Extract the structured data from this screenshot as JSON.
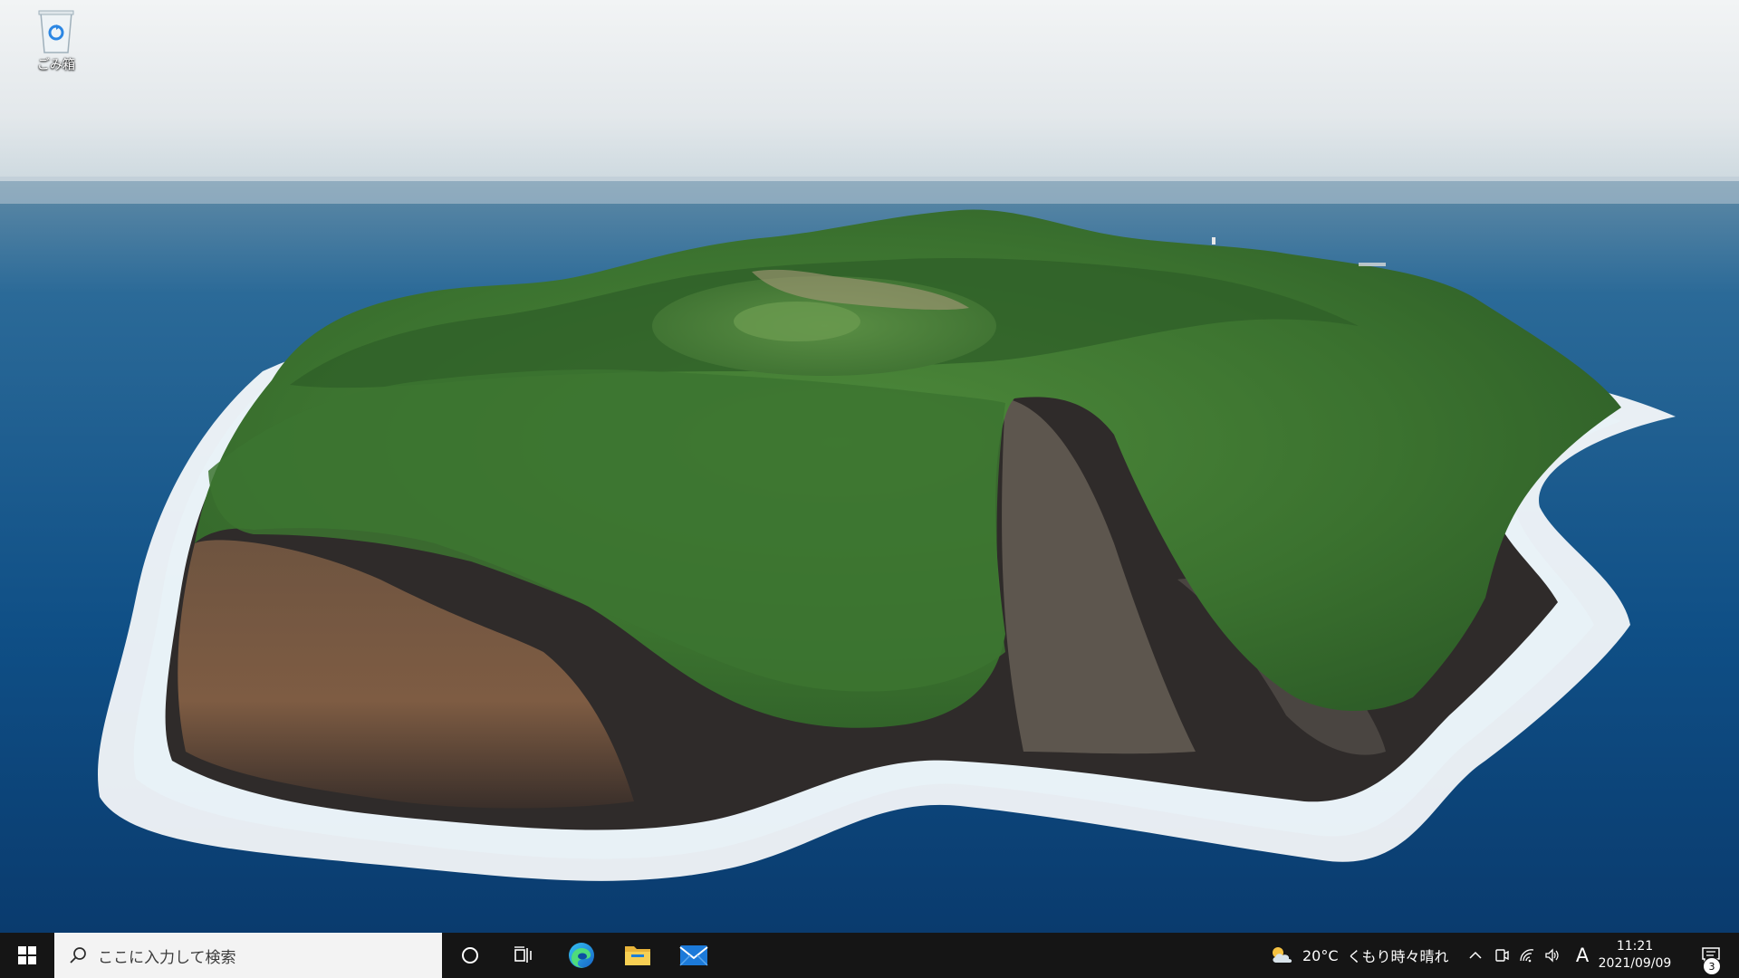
{
  "desktop": {
    "icons": [
      {
        "label": "ごみ箱",
        "icon": "recycle-bin-icon"
      }
    ],
    "wallpaper": "aerial-volcanic-island"
  },
  "taskbar": {
    "start_icon": "windows-logo-icon",
    "search": {
      "placeholder": "ここに入力して検索",
      "icon": "search-icon"
    },
    "cortana_icon": "cortana-circle-icon",
    "taskview_icon": "task-view-icon",
    "pinned_apps": [
      {
        "name": "Microsoft Edge",
        "icon": "edge-icon"
      },
      {
        "name": "エクスプローラー",
        "icon": "folder-icon"
      },
      {
        "name": "メール",
        "icon": "mail-icon"
      }
    ],
    "weather": {
      "temperature": "20°C",
      "condition": "くもり時々晴れ",
      "icon": "partly-cloudy-icon"
    },
    "tray": {
      "chevron_icon": "chevron-up-icon",
      "meet_icon": "meet-now-icon",
      "network_icon": "wifi-icon",
      "volume_icon": "speaker-icon",
      "ime_indicator": "A"
    },
    "clock": {
      "time": "11:21",
      "date": "2021/09/09"
    },
    "notifications": {
      "count": "3",
      "icon": "action-center-icon"
    }
  },
  "colors": {
    "taskbar_bg": "#151515",
    "search_bg": "#f3f3f3",
    "ocean": "#0e4f85",
    "island_green": "#3f7a33",
    "cliff": "#7a5b45",
    "sky": "#e7ecef"
  }
}
